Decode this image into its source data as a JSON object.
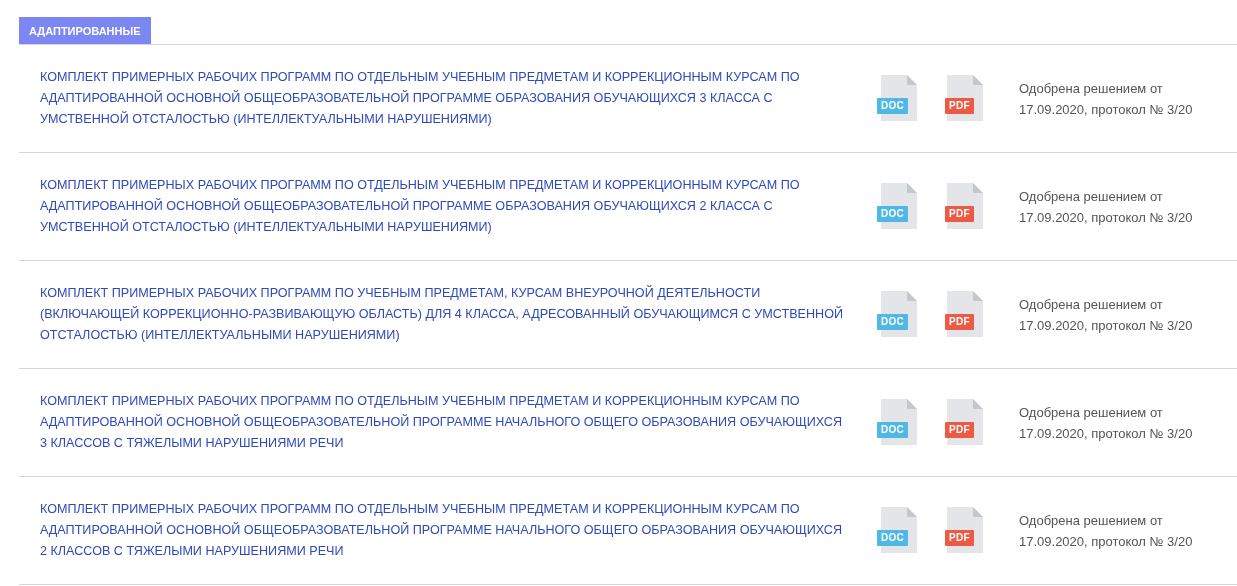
{
  "tab": {
    "label": "АДАПТИРОВАННЫЕ",
    "selected": true
  },
  "documents": [
    {
      "title": "КОМПЛЕКТ ПРИМЕРНЫХ РАБОЧИХ ПРОГРАММ ПО ОТДЕЛЬНЫМ УЧЕБНЫМ ПРЕДМЕТАМ И КОРРЕКЦИОННЫМ КУРСАМ ПО АДАПТИРОВАННОЙ ОСНОВНОЙ ОБЩЕОБРАЗОВАТЕЛЬНОЙ ПРОГРАММЕ ОБРАЗОВАНИЯ ОБУЧАЮЩИХСЯ 3 КЛАССА С УМСТВЕННОЙ ОТСТАЛОСТЬЮ (ИНТЕЛЛЕКТУАЛЬНЫМИ НАРУШЕНИЯМИ)",
      "files": [
        {
          "kind": "doc",
          "label": "DOC"
        },
        {
          "kind": "pdf",
          "label": "PDF"
        }
      ],
      "status": "Одобрена решением от 17.09.2020, протокол № 3/20"
    },
    {
      "title": "КОМПЛЕКТ ПРИМЕРНЫХ РАБОЧИХ ПРОГРАММ ПО ОТДЕЛЬНЫМ УЧЕБНЫМ ПРЕДМЕТАМ И КОРРЕКЦИОННЫМ КУРСАМ ПО АДАПТИРОВАННОЙ ОСНОВНОЙ ОБЩЕОБРАЗОВАТЕЛЬНОЙ ПРОГРАММЕ ОБРАЗОВАНИЯ ОБУЧАЮЩИХСЯ 2 КЛАССА С УМСТВЕННОЙ ОТСТАЛОСТЬЮ (ИНТЕЛЛЕКТУАЛЬНЫМИ НАРУШЕНИЯМИ)",
      "files": [
        {
          "kind": "doc",
          "label": "DOC"
        },
        {
          "kind": "pdf",
          "label": "PDF"
        }
      ],
      "status": "Одобрена решением от 17.09.2020, протокол № 3/20"
    },
    {
      "title": "КОМПЛЕКТ ПРИМЕРНЫХ РАБОЧИХ ПРОГРАММ ПО УЧЕБНЫМ ПРЕДМЕТАМ, КУРСАМ ВНЕУРОЧНОЙ ДЕЯТЕЛЬНОСТИ (ВКЛЮЧАЮЩЕЙ КОРРЕКЦИОННО-РАЗВИВАЮЩУЮ ОБЛАСТЬ) ДЛЯ 4 КЛАССА, АДРЕСОВАННЫЙ ОБУЧАЮЩИМСЯ С УМСТВЕННОЙ ОТСТАЛОСТЬЮ (ИНТЕЛЛЕКТУАЛЬНЫМИ НАРУШЕНИЯМИ)",
      "files": [
        {
          "kind": "doc",
          "label": "DOC"
        },
        {
          "kind": "pdf",
          "label": "PDF"
        }
      ],
      "status": "Одобрена решением от 17.09.2020, протокол № 3/20"
    },
    {
      "title": "КОМПЛЕКТ ПРИМЕРНЫХ РАБОЧИХ ПРОГРАММ ПО ОТДЕЛЬНЫМ УЧЕБНЫМ ПРЕДМЕТАМ И КОРРЕКЦИОННЫМ КУРСАМ ПО АДАПТИРОВАННОЙ ОСНОВНОЙ ОБЩЕОБРАЗОВАТЕЛЬНОЙ ПРОГРАММЕ НАЧАЛЬНОГО ОБЩЕГО ОБРАЗОВАНИЯ ОБУЧАЮЩИХСЯ 3 КЛАССОВ С ТЯЖЕЛЫМИ НАРУШЕНИЯМИ РЕЧИ",
      "files": [
        {
          "kind": "doc",
          "label": "DOC"
        },
        {
          "kind": "pdf",
          "label": "PDF"
        }
      ],
      "status": "Одобрена решением от 17.09.2020, протокол № 3/20"
    },
    {
      "title": "КОМПЛЕКТ ПРИМЕРНЫХ РАБОЧИХ ПРОГРАММ ПО ОТДЕЛЬНЫМ УЧЕБНЫМ ПРЕДМЕТАМ И КОРРЕКЦИОННЫМ КУРСАМ ПО АДАПТИРОВАННОЙ ОСНОВНОЙ ОБЩЕОБРАЗОВАТЕЛЬНОЙ ПРОГРАММЕ НАЧАЛЬНОГО ОБЩЕГО ОБРАЗОВАНИЯ ОБУЧАЮЩИХСЯ 2 КЛАССОВ С ТЯЖЕЛЫМИ НАРУШЕНИЯМИ РЕЧИ",
      "files": [
        {
          "kind": "doc",
          "label": "DOC"
        },
        {
          "kind": "pdf",
          "label": "PDF"
        }
      ],
      "status": "Одобрена решением от 17.09.2020, протокол № 3/20"
    }
  ]
}
